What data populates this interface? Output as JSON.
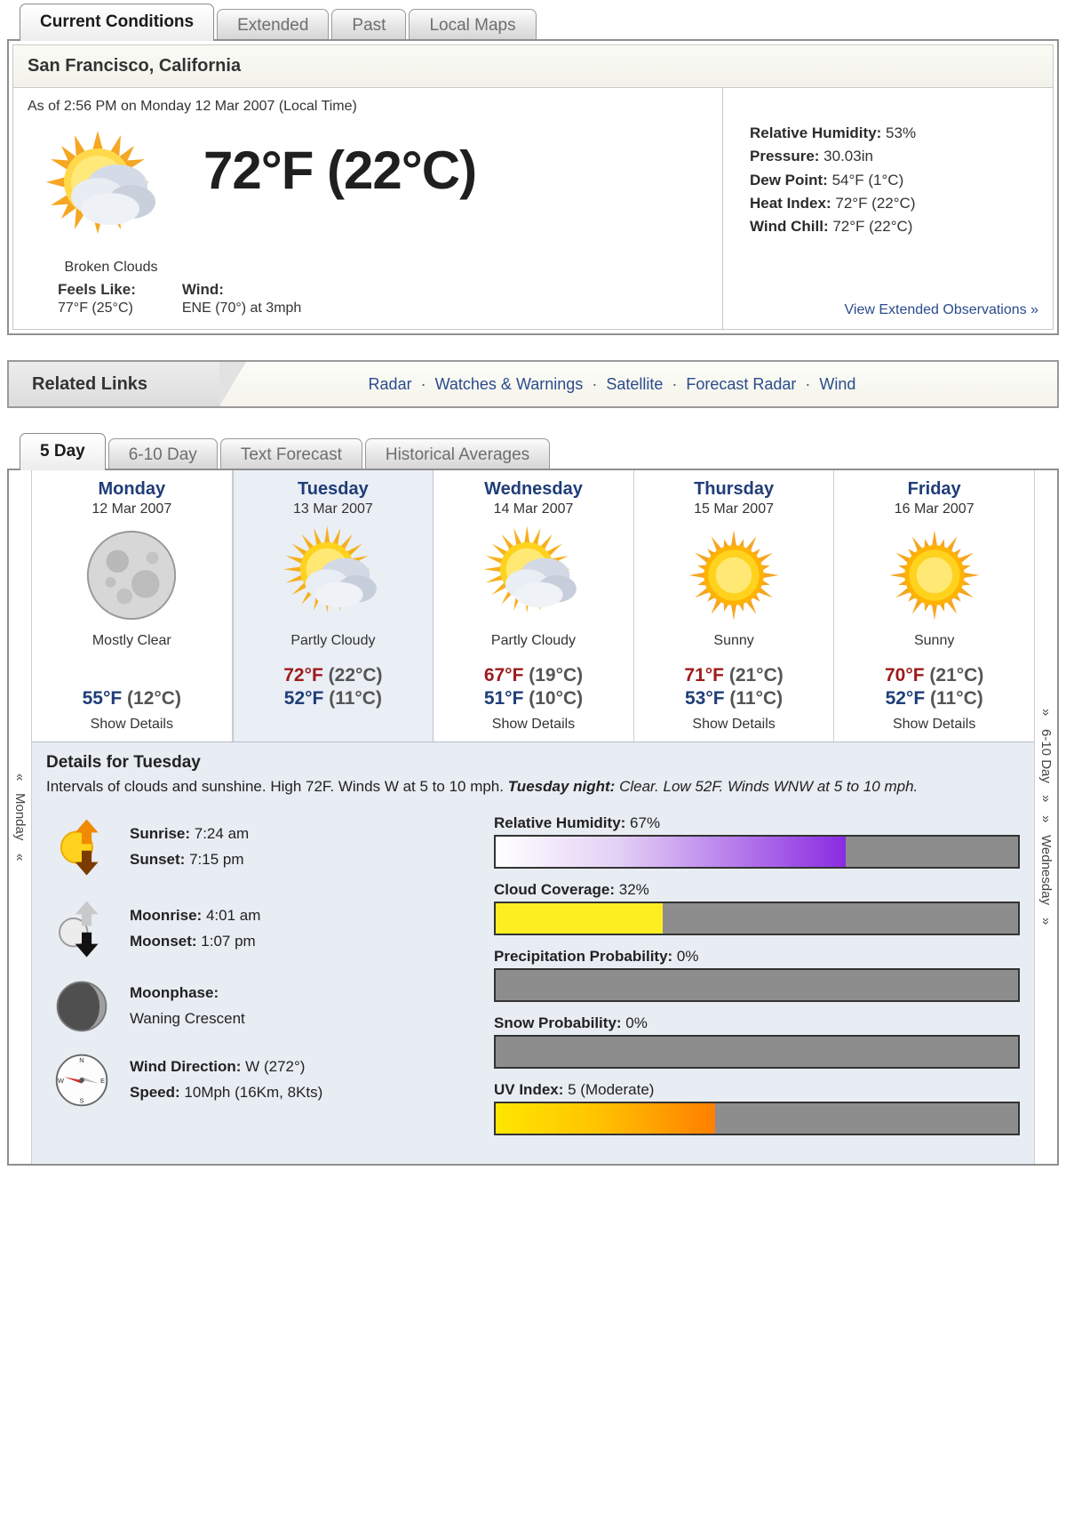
{
  "top_tabs": [
    {
      "label": "Current Conditions",
      "active": true
    },
    {
      "label": "Extended",
      "active": false
    },
    {
      "label": "Past",
      "active": false
    },
    {
      "label": "Local Maps",
      "active": false
    }
  ],
  "current": {
    "location": "San Francisco, California",
    "as_of": "As of 2:56 PM on Monday 12 Mar 2007 (Local Time)",
    "icon": "sun-behind-clouds-icon",
    "condition": "Broken Clouds",
    "temperature": "72°F (22°C)",
    "feels_like_label": "Feels Like:",
    "feels_like_value": "77°F (25°C)",
    "wind_label": "Wind:",
    "wind_value": "ENE (70°) at 3mph",
    "observations": [
      {
        "label": "Relative Humidity:",
        "value": "53%"
      },
      {
        "label": "Pressure:",
        "value": "30.03in"
      },
      {
        "label": "Dew Point:",
        "value": "54°F (1°C)"
      },
      {
        "label": "Heat Index:",
        "value": "72°F (22°C)"
      },
      {
        "label": "Wind Chill:",
        "value": "72°F (22°C)"
      }
    ],
    "extended_link": "View Extended Observations »"
  },
  "related": {
    "title": "Related Links",
    "links": [
      "Radar",
      "Watches & Warnings",
      "Satellite",
      "Forecast Radar",
      "Wind"
    ],
    "separator": "·"
  },
  "forecast_tabs": [
    {
      "label": "5 Day",
      "active": true
    },
    {
      "label": "6-10 Day",
      "active": false
    },
    {
      "label": "Text Forecast",
      "active": false
    },
    {
      "label": "Historical Averages",
      "active": false
    }
  ],
  "side_nav": {
    "left_label": "Monday",
    "left_arrows": "«",
    "right_label_top": "6-10 Day",
    "right_label_bottom": "Wednesday",
    "right_arrows": "»"
  },
  "forecast_days": [
    {
      "day": "Monday",
      "date": "12 Mar 2007",
      "icon": "full-moon-icon",
      "condition": "Mostly Clear",
      "high": "",
      "high_c": "",
      "low": "55°F",
      "low_c": "(12°C)",
      "details_link": "Show Details",
      "selected": false
    },
    {
      "day": "Tuesday",
      "date": "13 Mar 2007",
      "icon": "sun-behind-clouds-icon",
      "condition": "Partly Cloudy",
      "high": "72°F",
      "high_c": "(22°C)",
      "low": "52°F",
      "low_c": "(11°C)",
      "details_link": "",
      "selected": true
    },
    {
      "day": "Wednesday",
      "date": "14 Mar 2007",
      "icon": "sun-behind-clouds-icon",
      "condition": "Partly Cloudy",
      "high": "67°F",
      "high_c": "(19°C)",
      "low": "51°F",
      "low_c": "(10°C)",
      "details_link": "Show Details",
      "selected": false
    },
    {
      "day": "Thursday",
      "date": "15 Mar 2007",
      "icon": "sun-icon",
      "condition": "Sunny",
      "high": "71°F",
      "high_c": "(21°C)",
      "low": "53°F",
      "low_c": "(11°C)",
      "details_link": "Show Details",
      "selected": false
    },
    {
      "day": "Friday",
      "date": "16 Mar 2007",
      "icon": "sun-icon",
      "condition": "Sunny",
      "high": "70°F",
      "high_c": "(21°C)",
      "low": "52°F",
      "low_c": "(11°C)",
      "details_link": "Show Details",
      "selected": false
    }
  ],
  "details": {
    "title": "Details for Tuesday",
    "text_day": "Intervals of clouds and sunshine. High 72F. Winds W at 5 to 10 mph.",
    "text_night_label": "Tuesday night:",
    "text_night": "Clear. Low 52F. Winds WNW at 5 to 10 mph.",
    "astro": [
      {
        "icon": "sunrise-sunset-icon",
        "rows": [
          {
            "label": "Sunrise:",
            "value": "7:24 am"
          },
          {
            "label": "Sunset:",
            "value": "7:15 pm"
          }
        ]
      },
      {
        "icon": "moonrise-moonset-icon",
        "rows": [
          {
            "label": "Moonrise:",
            "value": "4:01 am"
          },
          {
            "label": "Moonset:",
            "value": "1:07 pm"
          }
        ]
      },
      {
        "icon": "moon-phase-icon",
        "rows": [
          {
            "label": "Moonphase:",
            "value": ""
          },
          {
            "label": "",
            "value": "Waning Crescent"
          }
        ]
      },
      {
        "icon": "compass-icon",
        "rows": [
          {
            "label": "Wind Direction:",
            "value": "W (272°)"
          },
          {
            "label": "Speed:",
            "value": "10Mph (16Km, 8Kts)"
          }
        ]
      }
    ],
    "bars": [
      {
        "label": "Relative Humidity:",
        "value": "67%",
        "percent": 67,
        "fill": "fill-humidity"
      },
      {
        "label": "Cloud Coverage:",
        "value": "32%",
        "percent": 32,
        "fill": "fill-cloud"
      },
      {
        "label": "Precipitation Probability:",
        "value": "0%",
        "percent": 0,
        "fill": ""
      },
      {
        "label": "Snow Probability:",
        "value": "0%",
        "percent": 0,
        "fill": ""
      },
      {
        "label": "UV Index:",
        "value": "5 (Moderate)",
        "percent": 42,
        "fill": "fill-uv"
      }
    ]
  },
  "colors": {
    "high_temp": "#9d1b1b",
    "low_temp": "#1f3d78",
    "link": "#2b4b8c",
    "humidity_bar": "#8a2be2",
    "cloud_bar": "#fcee21",
    "uv_bar": "#ff7f00",
    "bar_track": "#8d8d8d"
  }
}
